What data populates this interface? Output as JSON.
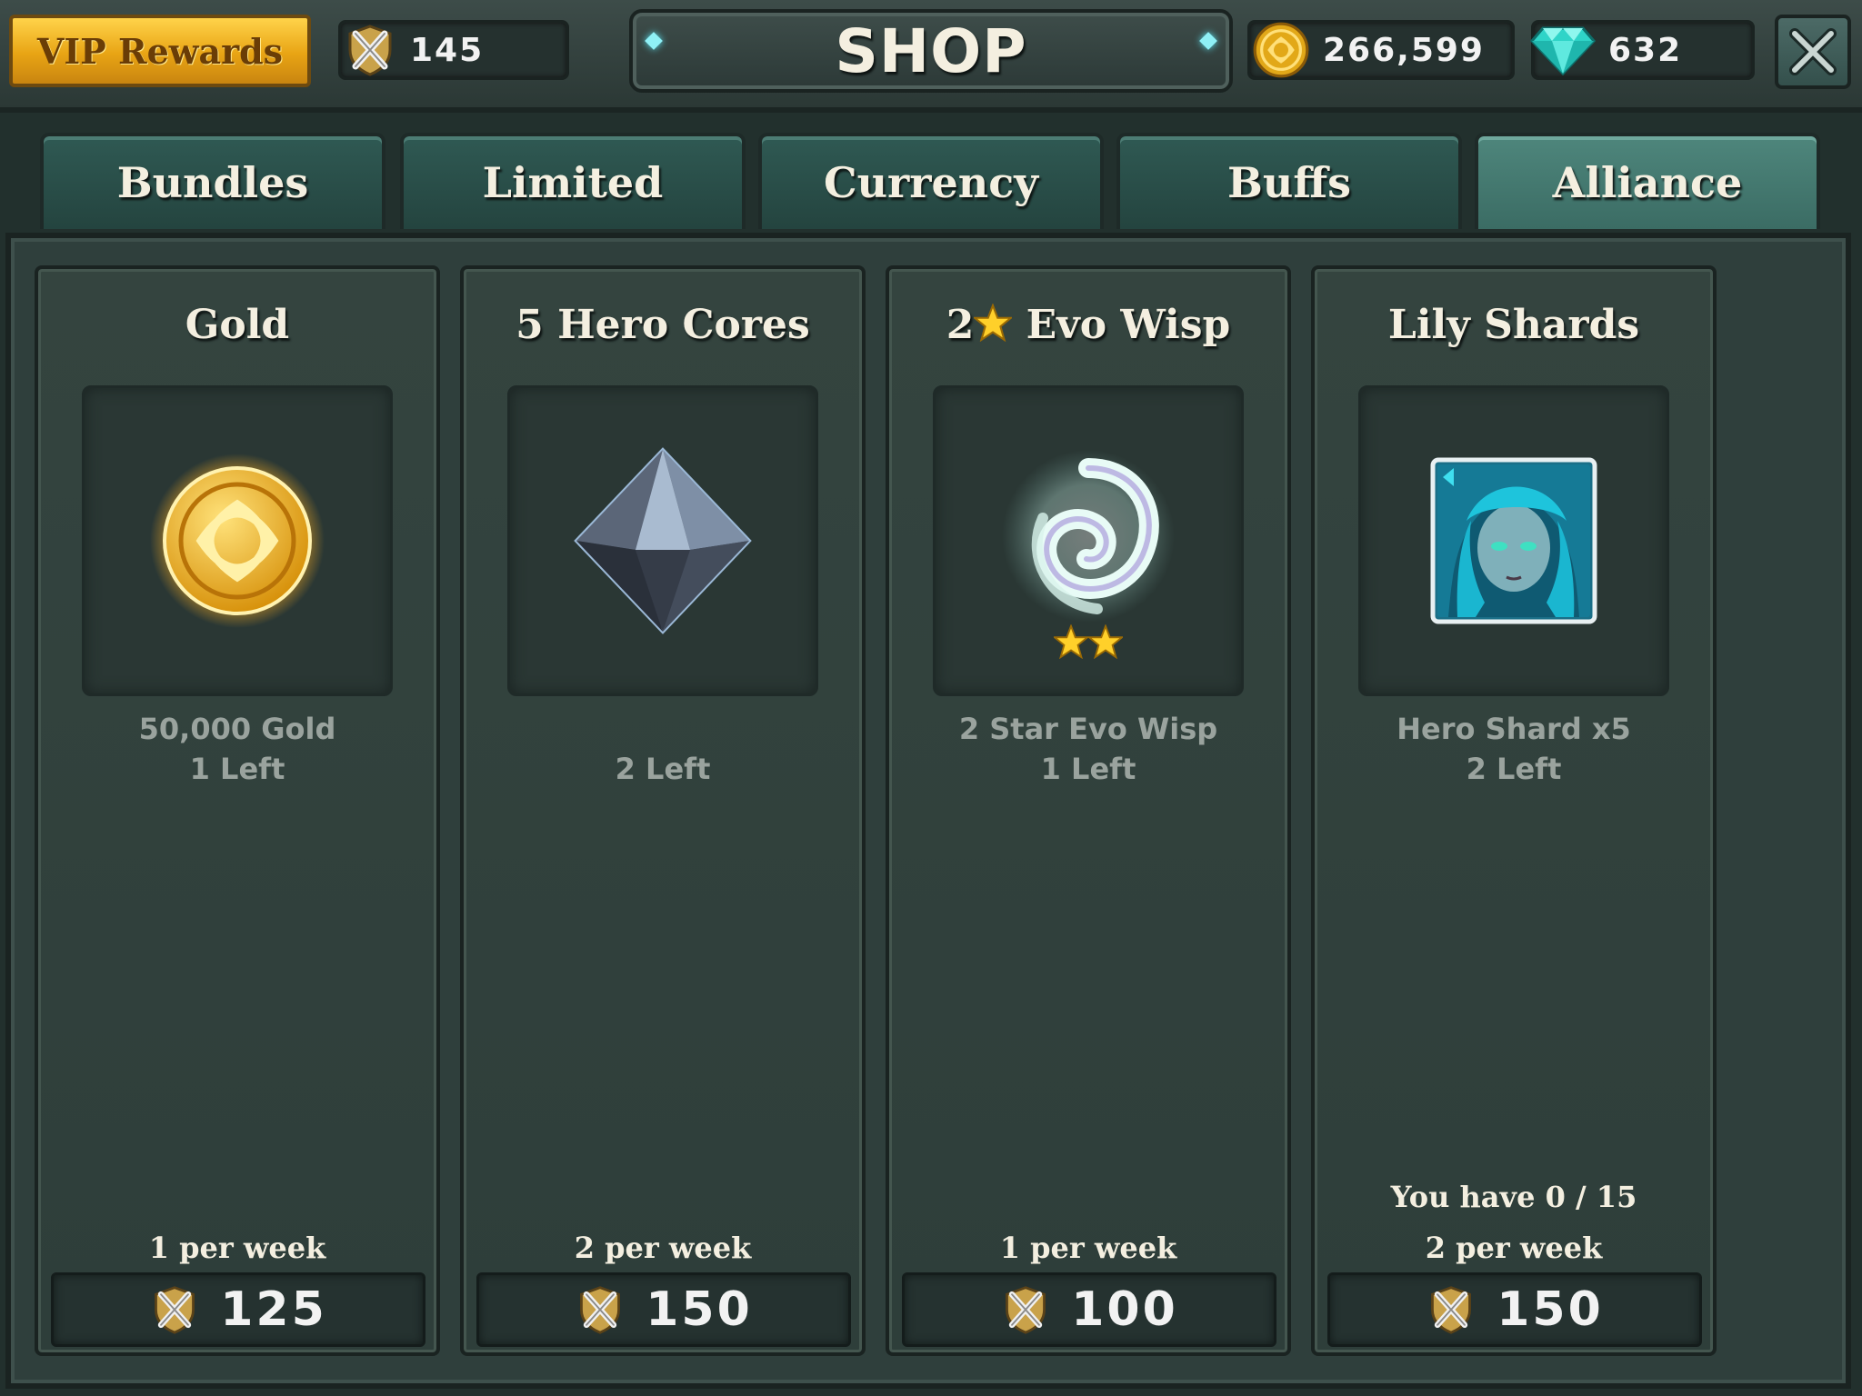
{
  "topbar": {
    "vip_label": "VIP Rewards",
    "alliance_tokens": "145",
    "title": "SHOP",
    "gold": "266,599",
    "gems": "632"
  },
  "tabs": [
    {
      "label": "Bundles",
      "active": false
    },
    {
      "label": "Limited",
      "active": false
    },
    {
      "label": "Currency",
      "active": false
    },
    {
      "label": "Buffs",
      "active": false
    },
    {
      "label": "Alliance",
      "active": true
    }
  ],
  "items": [
    {
      "title": "Gold",
      "desc_line1": "50,000 Gold",
      "desc_line2": "1 Left",
      "have": "",
      "per_week": "1 per week",
      "price": "125",
      "icon": "gold-coin-icon"
    },
    {
      "title": "5 Hero Cores",
      "desc_line1": "",
      "desc_line2": "2 Left",
      "have": "",
      "per_week": "2 per week",
      "price": "150",
      "icon": "hero-core-icon"
    },
    {
      "title_prefix": "2",
      "title_suffix": " Evo Wisp",
      "desc_line1": "2 Star Evo Wisp",
      "desc_line2": "1 Left",
      "have": "",
      "per_week": "1 per week",
      "price": "100",
      "icon": "evo-wisp-icon",
      "stars": 2
    },
    {
      "title": "Lily Shards",
      "desc_line1": "Hero Shard x5",
      "desc_line2": "2 Left",
      "have": "You have 0 / 15",
      "per_week": "2 per week",
      "price": "150",
      "icon": "hero-portrait-icon"
    }
  ],
  "colors": {
    "vip_gold": "#e8a414",
    "active_tab": "#4e867c",
    "panel": "#2f3f3c",
    "gem": "#59e0ef"
  }
}
